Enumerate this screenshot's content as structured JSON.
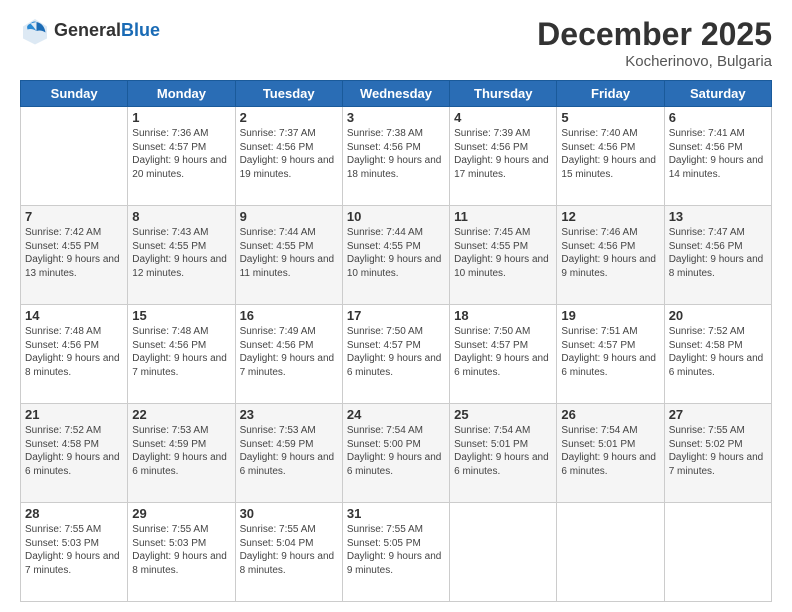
{
  "header": {
    "logo_line1": "General",
    "logo_line2": "Blue",
    "month": "December 2025",
    "location": "Kocherinovo, Bulgaria"
  },
  "days_of_week": [
    "Sunday",
    "Monday",
    "Tuesday",
    "Wednesday",
    "Thursday",
    "Friday",
    "Saturday"
  ],
  "weeks": [
    [
      {
        "day": "",
        "sunrise": "",
        "sunset": "",
        "daylight": ""
      },
      {
        "day": "1",
        "sunrise": "Sunrise: 7:36 AM",
        "sunset": "Sunset: 4:57 PM",
        "daylight": "Daylight: 9 hours and 20 minutes."
      },
      {
        "day": "2",
        "sunrise": "Sunrise: 7:37 AM",
        "sunset": "Sunset: 4:56 PM",
        "daylight": "Daylight: 9 hours and 19 minutes."
      },
      {
        "day": "3",
        "sunrise": "Sunrise: 7:38 AM",
        "sunset": "Sunset: 4:56 PM",
        "daylight": "Daylight: 9 hours and 18 minutes."
      },
      {
        "day": "4",
        "sunrise": "Sunrise: 7:39 AM",
        "sunset": "Sunset: 4:56 PM",
        "daylight": "Daylight: 9 hours and 17 minutes."
      },
      {
        "day": "5",
        "sunrise": "Sunrise: 7:40 AM",
        "sunset": "Sunset: 4:56 PM",
        "daylight": "Daylight: 9 hours and 15 minutes."
      },
      {
        "day": "6",
        "sunrise": "Sunrise: 7:41 AM",
        "sunset": "Sunset: 4:56 PM",
        "daylight": "Daylight: 9 hours and 14 minutes."
      }
    ],
    [
      {
        "day": "7",
        "sunrise": "Sunrise: 7:42 AM",
        "sunset": "Sunset: 4:55 PM",
        "daylight": "Daylight: 9 hours and 13 minutes."
      },
      {
        "day": "8",
        "sunrise": "Sunrise: 7:43 AM",
        "sunset": "Sunset: 4:55 PM",
        "daylight": "Daylight: 9 hours and 12 minutes."
      },
      {
        "day": "9",
        "sunrise": "Sunrise: 7:44 AM",
        "sunset": "Sunset: 4:55 PM",
        "daylight": "Daylight: 9 hours and 11 minutes."
      },
      {
        "day": "10",
        "sunrise": "Sunrise: 7:44 AM",
        "sunset": "Sunset: 4:55 PM",
        "daylight": "Daylight: 9 hours and 10 minutes."
      },
      {
        "day": "11",
        "sunrise": "Sunrise: 7:45 AM",
        "sunset": "Sunset: 4:55 PM",
        "daylight": "Daylight: 9 hours and 10 minutes."
      },
      {
        "day": "12",
        "sunrise": "Sunrise: 7:46 AM",
        "sunset": "Sunset: 4:56 PM",
        "daylight": "Daylight: 9 hours and 9 minutes."
      },
      {
        "day": "13",
        "sunrise": "Sunrise: 7:47 AM",
        "sunset": "Sunset: 4:56 PM",
        "daylight": "Daylight: 9 hours and 8 minutes."
      }
    ],
    [
      {
        "day": "14",
        "sunrise": "Sunrise: 7:48 AM",
        "sunset": "Sunset: 4:56 PM",
        "daylight": "Daylight: 9 hours and 8 minutes."
      },
      {
        "day": "15",
        "sunrise": "Sunrise: 7:48 AM",
        "sunset": "Sunset: 4:56 PM",
        "daylight": "Daylight: 9 hours and 7 minutes."
      },
      {
        "day": "16",
        "sunrise": "Sunrise: 7:49 AM",
        "sunset": "Sunset: 4:56 PM",
        "daylight": "Daylight: 9 hours and 7 minutes."
      },
      {
        "day": "17",
        "sunrise": "Sunrise: 7:50 AM",
        "sunset": "Sunset: 4:57 PM",
        "daylight": "Daylight: 9 hours and 6 minutes."
      },
      {
        "day": "18",
        "sunrise": "Sunrise: 7:50 AM",
        "sunset": "Sunset: 4:57 PM",
        "daylight": "Daylight: 9 hours and 6 minutes."
      },
      {
        "day": "19",
        "sunrise": "Sunrise: 7:51 AM",
        "sunset": "Sunset: 4:57 PM",
        "daylight": "Daylight: 9 hours and 6 minutes."
      },
      {
        "day": "20",
        "sunrise": "Sunrise: 7:52 AM",
        "sunset": "Sunset: 4:58 PM",
        "daylight": "Daylight: 9 hours and 6 minutes."
      }
    ],
    [
      {
        "day": "21",
        "sunrise": "Sunrise: 7:52 AM",
        "sunset": "Sunset: 4:58 PM",
        "daylight": "Daylight: 9 hours and 6 minutes."
      },
      {
        "day": "22",
        "sunrise": "Sunrise: 7:53 AM",
        "sunset": "Sunset: 4:59 PM",
        "daylight": "Daylight: 9 hours and 6 minutes."
      },
      {
        "day": "23",
        "sunrise": "Sunrise: 7:53 AM",
        "sunset": "Sunset: 4:59 PM",
        "daylight": "Daylight: 9 hours and 6 minutes."
      },
      {
        "day": "24",
        "sunrise": "Sunrise: 7:54 AM",
        "sunset": "Sunset: 5:00 PM",
        "daylight": "Daylight: 9 hours and 6 minutes."
      },
      {
        "day": "25",
        "sunrise": "Sunrise: 7:54 AM",
        "sunset": "Sunset: 5:01 PM",
        "daylight": "Daylight: 9 hours and 6 minutes."
      },
      {
        "day": "26",
        "sunrise": "Sunrise: 7:54 AM",
        "sunset": "Sunset: 5:01 PM",
        "daylight": "Daylight: 9 hours and 6 minutes."
      },
      {
        "day": "27",
        "sunrise": "Sunrise: 7:55 AM",
        "sunset": "Sunset: 5:02 PM",
        "daylight": "Daylight: 9 hours and 7 minutes."
      }
    ],
    [
      {
        "day": "28",
        "sunrise": "Sunrise: 7:55 AM",
        "sunset": "Sunset: 5:03 PM",
        "daylight": "Daylight: 9 hours and 7 minutes."
      },
      {
        "day": "29",
        "sunrise": "Sunrise: 7:55 AM",
        "sunset": "Sunset: 5:03 PM",
        "daylight": "Daylight: 9 hours and 8 minutes."
      },
      {
        "day": "30",
        "sunrise": "Sunrise: 7:55 AM",
        "sunset": "Sunset: 5:04 PM",
        "daylight": "Daylight: 9 hours and 8 minutes."
      },
      {
        "day": "31",
        "sunrise": "Sunrise: 7:55 AM",
        "sunset": "Sunset: 5:05 PM",
        "daylight": "Daylight: 9 hours and 9 minutes."
      },
      {
        "day": "",
        "sunrise": "",
        "sunset": "",
        "daylight": ""
      },
      {
        "day": "",
        "sunrise": "",
        "sunset": "",
        "daylight": ""
      },
      {
        "day": "",
        "sunrise": "",
        "sunset": "",
        "daylight": ""
      }
    ]
  ]
}
